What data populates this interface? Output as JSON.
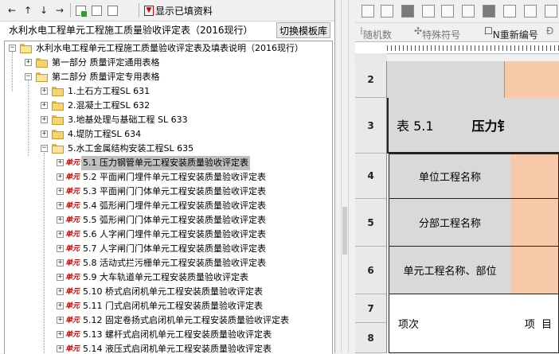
{
  "left_toolbar": {
    "buttons": [
      {
        "name": "arrow-left-icon",
        "glyph": "←"
      },
      {
        "name": "arrow-up-icon",
        "glyph": "↑"
      },
      {
        "name": "arrow-down-icon",
        "glyph": "↓"
      },
      {
        "name": "arrow-right-icon",
        "glyph": "→"
      }
    ],
    "show_filled_label": "显示已填资料"
  },
  "title": "水利水电工程单元工程施工质量验收评定表（2016现行）",
  "switch_button": "切换模板库",
  "tree": {
    "root": "水利水电工程单元工程施工质量验收评定表及填表说明（2016现行）",
    "part1": "第一部分  质量评定通用表格",
    "part2": "第二部分 质量评定专用表格",
    "sections": [
      "1.土石方工程SL 631",
      "2.混凝土工程SL 632",
      "3.地基处理与基础工程 SL 633",
      "4.堤防工程SL 634",
      "5.水工金属结构安装工程SL 635"
    ],
    "doc_badge": "单元",
    "items": [
      "5.1 压力钢管单元工程安装质量验收评定表",
      "5.2 平面闸门埋件单元工程安装质量验收评定表",
      "5.3 平面闸门门体单元工程安装质量验收评定表",
      "5.4 弧形闸门埋件单元工程安装质量验收评定表",
      "5.5 弧形闸门门体单元工程安装质量验收评定表",
      "5.6 人字闸门埋件单元工程安装质量验收评定表",
      "5.7 人字闸门门体单元工程安装质量验收评定表",
      "5.8 活动式拦污栅单元工程安装质量验收评定表",
      "5.9 大车轨道单元工程安装质量验收评定表",
      "5.10 桥式启闭机单元工程安装质量验收评定表",
      "5.11 门式启闭机单元工程安装质量验收评定表",
      "5.12 固定卷扬式启闭机单元工程安装质量验收评定表",
      "5.13 螺杆式启闭机单元工程安装质量验收评定表",
      "5.14 液压式启闭机单元工程安装质量验收评定表"
    ]
  },
  "right_toolbar2": {
    "random": "随机数",
    "special": "特殊符号",
    "renumber": "N重新编号",
    "more": "Đ"
  },
  "sheet": {
    "row_numbers": [
      "2",
      "3",
      "4",
      "5",
      "6",
      "7",
      "8"
    ],
    "table_no": "表 5.1",
    "table_title_fragment": "压力钅",
    "unit_project_name": "单位工程名称",
    "sub_project_name": "分部工程名称",
    "unit_element": "单元工程名称、部位",
    "item_no": "项次",
    "item": "项  目"
  },
  "colors": {
    "peach": "#f6c9a8",
    "gray": "#d9d9d9",
    "selected": "#bfbfbf",
    "doc_badge": "#c80000"
  }
}
